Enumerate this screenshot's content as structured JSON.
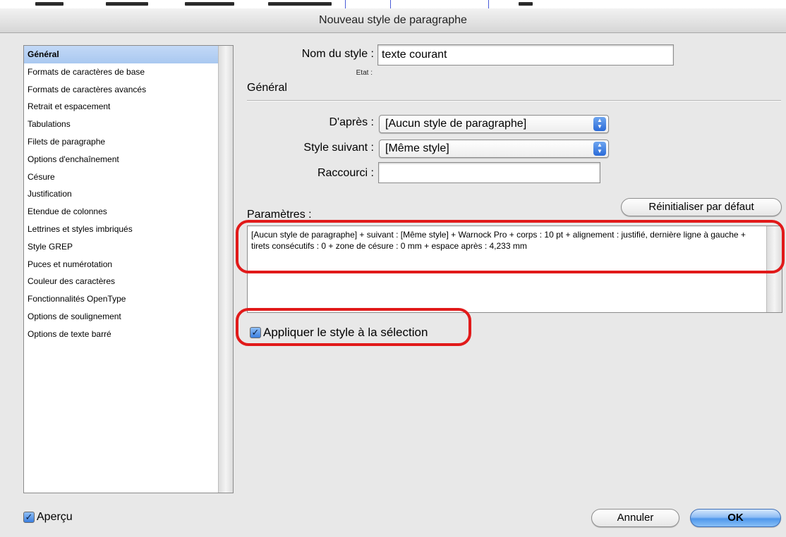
{
  "window": {
    "title": "Nouveau style de paragraphe"
  },
  "sidebar": {
    "items": [
      {
        "label": "Général",
        "selected": true
      },
      {
        "label": "Formats de caractères de base"
      },
      {
        "label": "Formats de caractères avancés"
      },
      {
        "label": "Retrait et espacement"
      },
      {
        "label": "Tabulations"
      },
      {
        "label": "Filets de paragraphe"
      },
      {
        "label": "Options d'enchaînement"
      },
      {
        "label": "Césure"
      },
      {
        "label": "Justification"
      },
      {
        "label": "Etendue de colonnes"
      },
      {
        "label": "Lettrines et styles imbriqués"
      },
      {
        "label": "Style GREP"
      },
      {
        "label": "Puces et numérotation"
      },
      {
        "label": "Couleur des caractères"
      },
      {
        "label": "Fonctionnalités OpenType"
      },
      {
        "label": "Options de soulignement"
      },
      {
        "label": "Options de texte barré"
      }
    ]
  },
  "form": {
    "style_name_label": "Nom du style :",
    "style_name_value": "texte courant",
    "state_label": "Etat :",
    "section_title": "Général",
    "based_on_label": "D'après :",
    "based_on_value": "[Aucun style de paragraphe]",
    "next_style_label": "Style suivant :",
    "next_style_value": "[Même style]",
    "shortcut_label": "Raccourci :",
    "shortcut_value": "",
    "reset_button": "Réinitialiser par défaut",
    "params_label": "Paramètres :",
    "params_text": "[Aucun style de paragraphe] + suivant : [Même style] + Warnock Pro + corps : 10 pt + alignement : justifié, dernière ligne à gauche + tirets consécutifs : 0 + zone de césure :  0 mm + espace après : 4,233 mm",
    "apply_checkbox_label": "Appliquer le style à la sélection",
    "apply_checked": true
  },
  "footer": {
    "preview_label": "Aperçu",
    "preview_checked": true,
    "cancel_button": "Annuler",
    "ok_button": "OK"
  },
  "colors": {
    "selection": "#a9c8f0",
    "highlight_red": "#e11a1a",
    "default_button_blue": "#4f97ec"
  },
  "icons": {
    "popup_arrows": "up-down-arrows-icon",
    "checkbox": "checkmark-icon"
  }
}
